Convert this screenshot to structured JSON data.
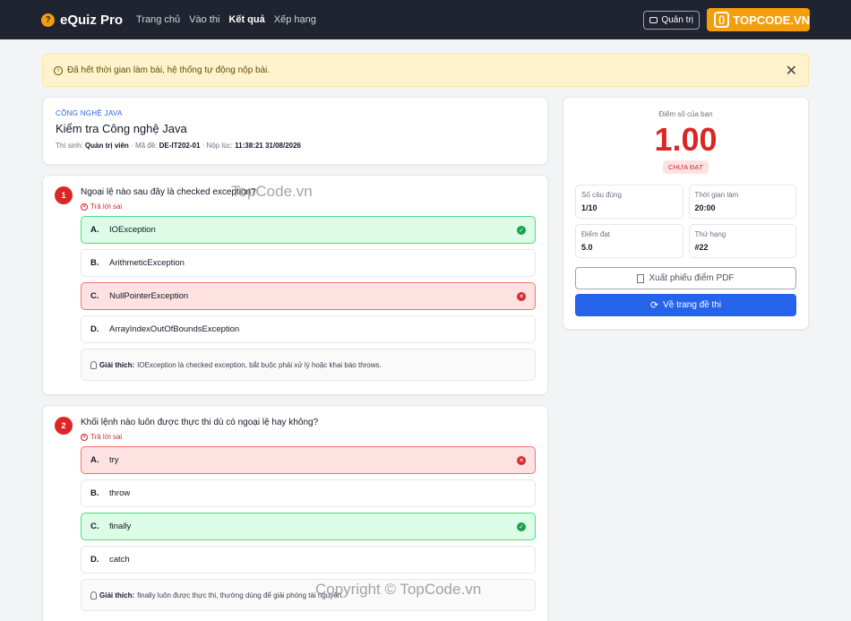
{
  "navbar": {
    "brand": "eQuiz Pro",
    "brand_icon": "question-mark-icon",
    "links": [
      "Trang chủ",
      "Vào thi",
      "Kết quả",
      "Xếp hạng"
    ],
    "active_link": "Kết quả",
    "admin_label": "Quản trị",
    "logo_text": "TOPCODE.VN"
  },
  "alert": {
    "message": "Đã hết thời gian làm bài, hệ thống tự động nộp bài.",
    "close": "✕"
  },
  "exam": {
    "subject": "CÔNG NGHỆ JAVA",
    "title": "Kiểm tra Công nghệ Java",
    "candidate_label": "Thí sinh:",
    "candidate": "Quản trị viên",
    "code_label": "· Mã đề:",
    "code": "DE-IT202-01",
    "submitted_label": "· Nộp lúc:",
    "submitted": "11:38:21 31/08/2026"
  },
  "questions": [
    {
      "number": "1",
      "text": "Ngoại lệ nào sau đây là checked exception?",
      "status": "Trả lời sai",
      "options": [
        {
          "letter": "A.",
          "text": "IOException",
          "state": "correct"
        },
        {
          "letter": "B.",
          "text": "ArithmeticException",
          "state": "none"
        },
        {
          "letter": "C.",
          "text": "NullPointerException",
          "state": "wrong"
        },
        {
          "letter": "D.",
          "text": "ArrayIndexOutOfBoundsException",
          "state": "none"
        }
      ],
      "explain_label": "Giải thích:",
      "explain": "IOException là checked exception, bắt buộc phải xử lý hoặc khai báo throws."
    },
    {
      "number": "2",
      "text": "Khối lệnh nào luôn được thực thi dù có ngoại lệ hay không?",
      "status": "Trả lời sai",
      "options": [
        {
          "letter": "A.",
          "text": "try",
          "state": "wrong"
        },
        {
          "letter": "B.",
          "text": "throw",
          "state": "none"
        },
        {
          "letter": "C.",
          "text": "finally",
          "state": "correct"
        },
        {
          "letter": "D.",
          "text": "catch",
          "state": "none"
        }
      ],
      "explain_label": "Giải thích:",
      "explain": "finally luôn được thực thi, thường dùng để giải phóng tài nguyên."
    }
  ],
  "score": {
    "label": "Điểm số của bạn",
    "value": "1.00",
    "badge": "CHƯA ĐẠT",
    "stats": [
      {
        "label": "Số câu đúng",
        "value": "1/10"
      },
      {
        "label": "Thời gian làm",
        "value": "20:00"
      },
      {
        "label": "Điểm đạt",
        "value": "5.0"
      },
      {
        "label": "Thứ hạng",
        "value": "#22"
      }
    ],
    "pdf_button": "Xuất phiếu điểm PDF",
    "back_button": "Về trang đề thi"
  },
  "watermarks": [
    "TopCode.vn",
    "Copyright © TopCode.vn"
  ],
  "colors": {
    "navbar": "#1f2430",
    "accent": "#2563eb",
    "danger": "#dc2626",
    "success": "#16a34a",
    "warning_bg": "#fff3cd"
  }
}
